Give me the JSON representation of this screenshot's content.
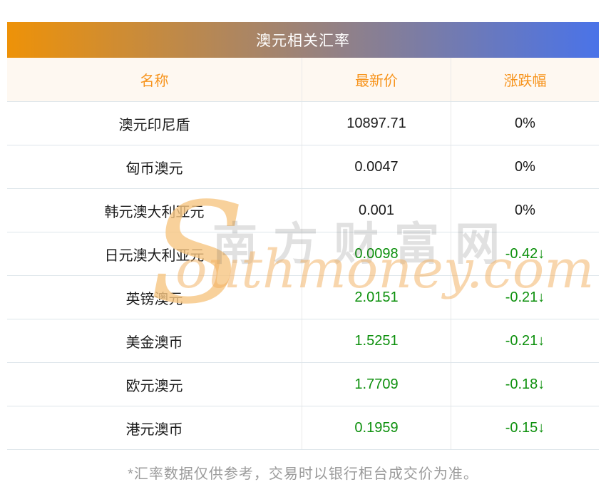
{
  "title": "澳元相关汇率",
  "table": {
    "columns": [
      "名称",
      "最新价",
      "涨跌幅"
    ],
    "rows": [
      {
        "name": "澳元印尼盾",
        "price": "10897.71",
        "change": "0%",
        "trend": "flat"
      },
      {
        "name": "匈币澳元",
        "price": "0.0047",
        "change": "0%",
        "trend": "flat"
      },
      {
        "name": "韩元澳大利亚元",
        "price": "0.001",
        "change": "0%",
        "trend": "flat"
      },
      {
        "name": "日元澳大利亚元",
        "price": "0.0098",
        "change": "-0.42↓",
        "trend": "down"
      },
      {
        "name": "英镑澳元",
        "price": "2.0151",
        "change": "-0.21↓",
        "trend": "down"
      },
      {
        "name": "美金澳币",
        "price": "1.5251",
        "change": "-0.21↓",
        "trend": "down"
      },
      {
        "name": "欧元澳元",
        "price": "1.7709",
        "change": "-0.18↓",
        "trend": "down"
      },
      {
        "name": "港元澳币",
        "price": "0.1959",
        "change": "-0.15↓",
        "trend": "down"
      }
    ]
  },
  "watermark": {
    "initial": "S",
    "cjk": "南方财富网",
    "latin": "outhmoney.com"
  },
  "footer": "*汇率数据仅供参考，交易时以银行柜台成交价为准。",
  "colors": {
    "gradient_start": "#ee9208",
    "gradient_end": "#4a73e8",
    "header_bg": "#fef8f1",
    "header_text": "#f7941d",
    "flat_text": "#1b1b1b",
    "down_text": "#0d900d",
    "footer_text": "#9b9b9b"
  }
}
